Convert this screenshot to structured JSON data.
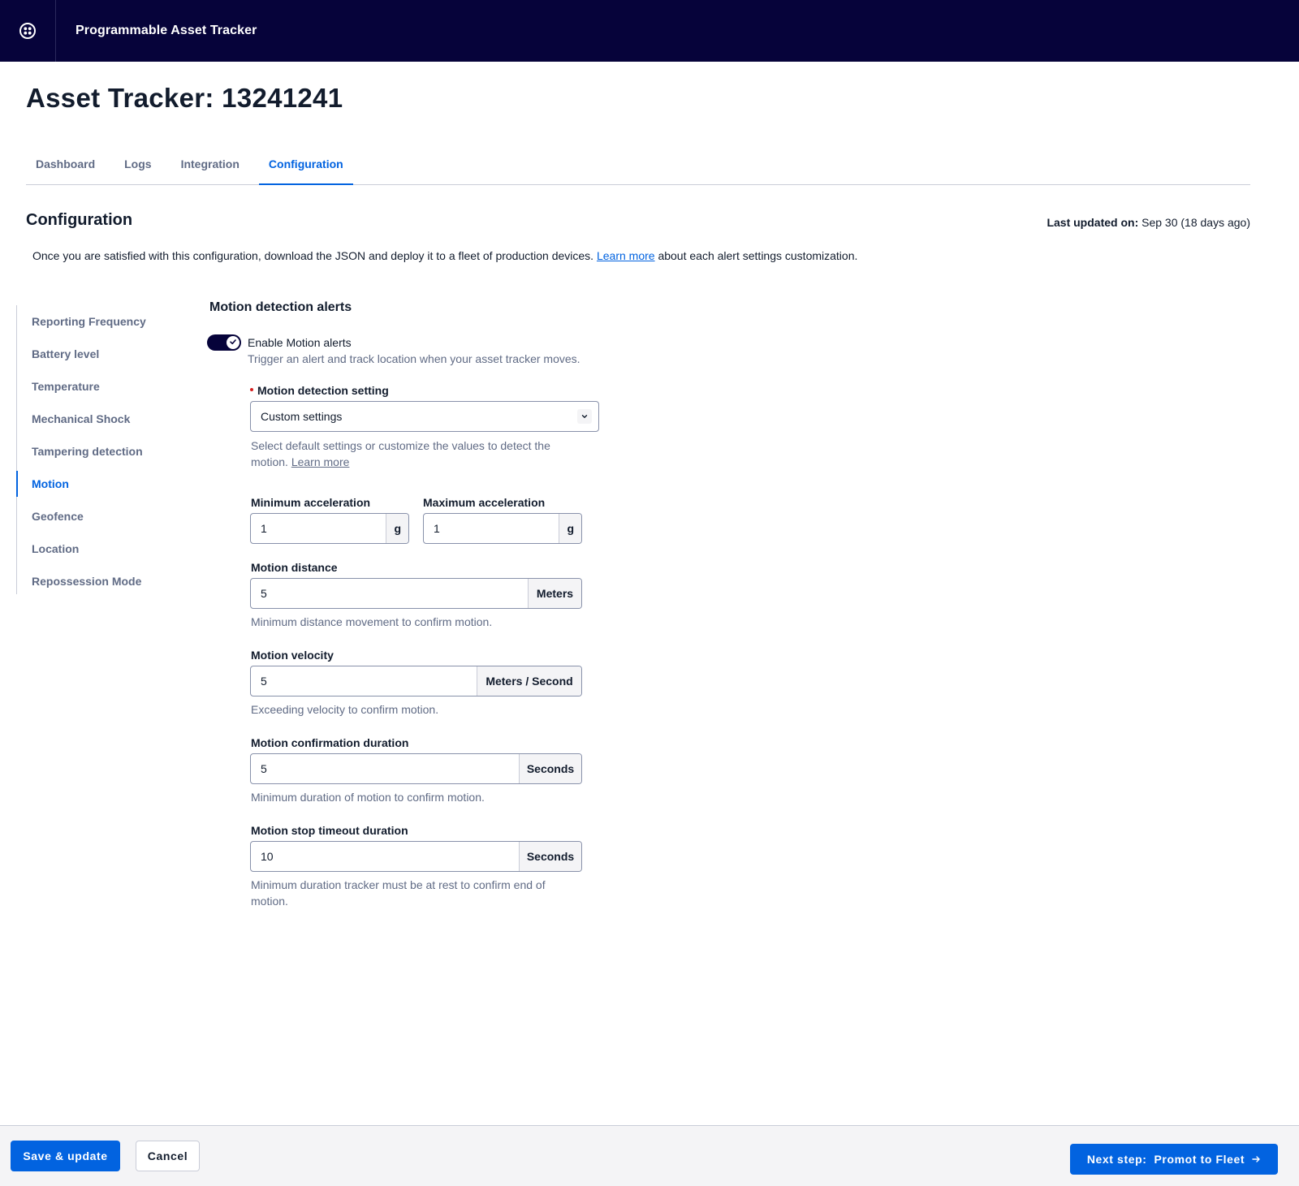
{
  "header": {
    "logo_icon": "product-logo-icon",
    "app_title": "Programmable Asset Tracker"
  },
  "page": {
    "title": "Asset Tracker: 13241241"
  },
  "tabs": [
    {
      "label": "Dashboard",
      "active": false
    },
    {
      "label": "Logs",
      "active": false
    },
    {
      "label": "Integration",
      "active": false
    },
    {
      "label": "Configuration",
      "active": true
    }
  ],
  "config": {
    "title": "Configuration",
    "last_updated_label": "Last updated on:",
    "last_updated_value": "Sep 30 (18 days ago)",
    "description_before": "Once you are satisfied with this configuration, download the JSON and deploy it to a fleet of production devices.",
    "description_link": "Learn more",
    "description_after": "about each alert settings customization."
  },
  "sidenav": {
    "items": [
      {
        "label": "Reporting Frequency"
      },
      {
        "label": "Battery level"
      },
      {
        "label": "Temperature"
      },
      {
        "label": "Mechanical Shock"
      },
      {
        "label": "Tampering detection"
      },
      {
        "label": "Motion",
        "active": true
      },
      {
        "label": "Geofence"
      },
      {
        "label": "Location"
      },
      {
        "label": "Repossession Mode"
      }
    ]
  },
  "form": {
    "title": "Motion detection alerts",
    "toggle": {
      "enabled": true,
      "label": "Enable Motion alerts",
      "help": "Trigger an alert and track location when your asset tracker moves."
    },
    "detection_setting": {
      "label": "Motion detection setting",
      "value": "Custom settings",
      "help_line1": "Select default settings or customize the values to detect the",
      "help_line2": "motion.",
      "help_link": "Learn more"
    },
    "min_accel": {
      "label": "Minimum acceleration",
      "value": "1",
      "unit": "g"
    },
    "max_accel": {
      "label": "Maximum acceleration",
      "value": "1",
      "unit": "g"
    },
    "distance": {
      "label": "Motion distance",
      "value": "5",
      "unit": "Meters",
      "help": "Minimum distance movement to confirm motion."
    },
    "velocity": {
      "label": "Motion velocity",
      "value": "5",
      "unit": "Meters / Second",
      "help": "Exceeding velocity to confirm motion."
    },
    "confirm_duration": {
      "label": "Motion confirmation duration",
      "value": "5",
      "unit": "Seconds",
      "help": "Minimum duration of motion to confirm motion."
    },
    "stop_timeout": {
      "label": "Motion stop timeout duration",
      "value": "10",
      "unit": "Seconds",
      "help_line1": "Minimum duration tracker must be at rest to confirm end of",
      "help_line2": "motion."
    }
  },
  "footer": {
    "save_label": "Save & update",
    "cancel_label": "Cancel",
    "next_label": "Next step:  Promot to Fleet"
  },
  "colors": {
    "topbar": "#06033a",
    "accent": "#0263e0",
    "muted_text": "#606b85"
  }
}
